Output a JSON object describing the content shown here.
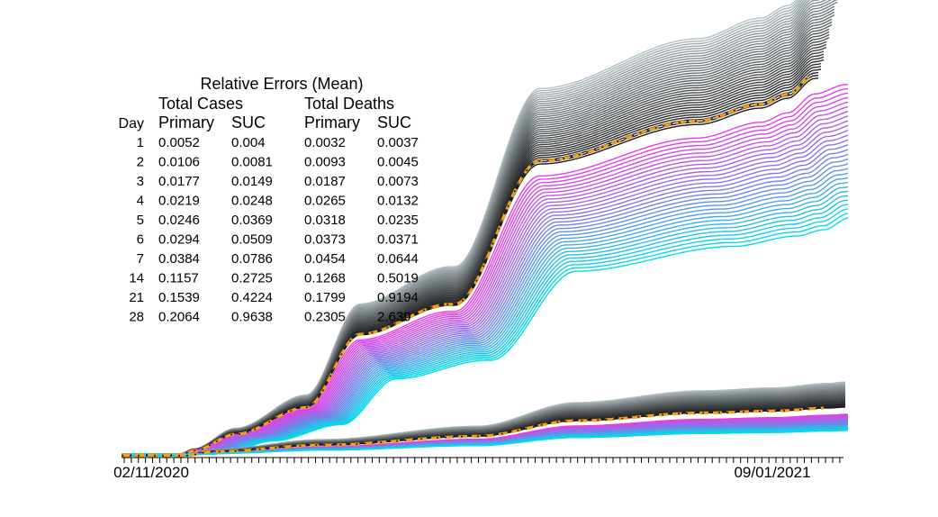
{
  "chart_data": {
    "type": "line",
    "title": "",
    "xlabel": "",
    "ylabel": "",
    "grid": false,
    "x_range": [
      "02/11/2020",
      "11/15/2021"
    ],
    "x_tick_labels": [
      "02/11/2020",
      "09/01/2021"
    ],
    "x_tick_interval_days": 7,
    "colors": {
      "prior_runs": "#1c1c1e",
      "prior_runs_light": "#b4c0c4",
      "cases_forecast_near": "#e83de6",
      "cases_forecast_mid": "#7a7fe8",
      "cases_forecast_far": "#00dde8",
      "actual_dash": "#f2a01c",
      "actual_dot": "#1a1a1a"
    },
    "table": {
      "title": "Relative Errors (Mean)",
      "group_headers": [
        "Total Cases",
        "Total Deaths"
      ],
      "column_headers": [
        "Day",
        "Primary",
        "SUC",
        "Primary",
        "SUC"
      ],
      "rows": [
        [
          "1",
          "0.0052",
          "0.004",
          "0.0032",
          "0.0037"
        ],
        [
          "2",
          "0.0106",
          "0.0081",
          "0.0093",
          "0.0045"
        ],
        [
          "3",
          "0.0177",
          "0.0149",
          "0.0187",
          "0.0073"
        ],
        [
          "4",
          "0.0219",
          "0.0248",
          "0.0265",
          "0.0132"
        ],
        [
          "5",
          "0.0246",
          "0.0369",
          "0.0318",
          "0.0235"
        ],
        [
          "6",
          "0.0294",
          "0.0509",
          "0.0373",
          "0.0371"
        ],
        [
          "7",
          "0.0384",
          "0.0786",
          "0.0454",
          "0.0644"
        ],
        [
          "14",
          "0.1157",
          "0.2725",
          "0.1268",
          "0.5019"
        ],
        [
          "21",
          "0.1539",
          "0.4224",
          "0.1799",
          "0.9194"
        ],
        [
          "28",
          "0.2064",
          "0.9638",
          "0.2305",
          "2.639"
        ]
      ]
    }
  }
}
